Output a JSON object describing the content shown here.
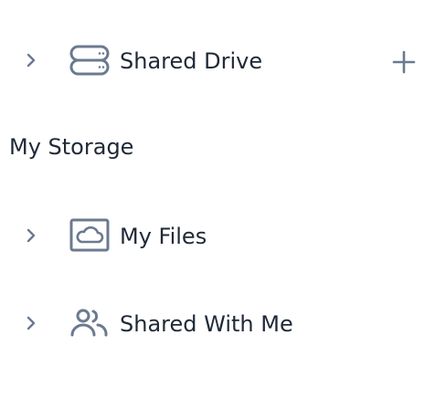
{
  "shared_drive": {
    "label": "Shared Drive",
    "icon": "drive-stack-icon",
    "expand_icon": "chevron-right-icon",
    "add_icon": "plus-icon"
  },
  "my_storage": {
    "title": "My Storage",
    "items": [
      {
        "label": "My Files",
        "icon": "cloud-folder-icon",
        "expand_icon": "chevron-right-icon"
      },
      {
        "label": "Shared With Me",
        "icon": "users-icon",
        "expand_icon": "chevron-right-icon"
      }
    ]
  },
  "colors": {
    "icon": "#6b7a90",
    "text": "#1f2937"
  }
}
